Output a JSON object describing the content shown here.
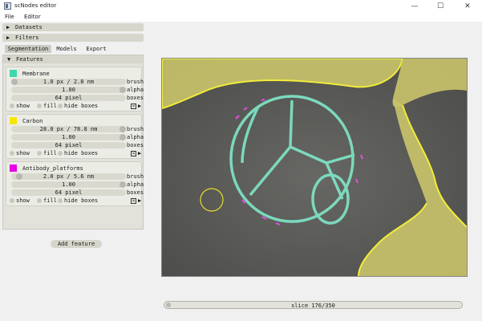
{
  "window": {
    "title": "scNodes editor",
    "minimize": "—",
    "maximize": "☐",
    "close": "✕"
  },
  "menu": {
    "file": "File",
    "editor": "Editor"
  },
  "sections": {
    "datasets": "Datasets",
    "filters": "Filters",
    "features": "Features"
  },
  "tabs": [
    "Segmentation",
    "Models",
    "Export"
  ],
  "features": [
    {
      "name": "Membrane",
      "color": "#40d8a8",
      "brush": "1.0 px / 2.8 nm",
      "alpha": "1.00",
      "boxes": "64 pixel",
      "brush_label": "brush",
      "alpha_label": "alpha",
      "boxes_label": "boxes",
      "show": "show",
      "fill": "fill",
      "hide": "hide boxes"
    },
    {
      "name": "Carbon",
      "color": "#f5e600",
      "brush": "28.0 px / 78.8 nm",
      "alpha": "1.00",
      "boxes": "64 pixel",
      "brush_label": "brush",
      "alpha_label": "alpha",
      "boxes_label": "boxes",
      "show": "show",
      "fill": "fill",
      "hide": "hide boxes"
    },
    {
      "name": "Antibody_platforms",
      "color": "#e600e6",
      "brush": "2.0 px / 5.6 nm",
      "alpha": "1.00",
      "boxes": "64 pixel",
      "brush_label": "brush",
      "alpha_label": "alpha",
      "boxes_label": "boxes",
      "show": "show",
      "fill": "fill",
      "hide": "hide boxes"
    }
  ],
  "add_feature": "Add feature",
  "slice": {
    "label": "slice 176/350",
    "current": 176,
    "total": 350
  }
}
